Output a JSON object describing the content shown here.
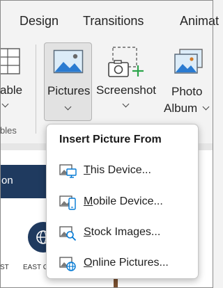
{
  "tabs": [
    "Design",
    "Transitions",
    "Animat"
  ],
  "ribbon": {
    "table_label": "able",
    "tables_group_label": "bles",
    "pictures_label": "Pictures",
    "screenshot_label": "Screenshot",
    "photo_album_label_1": "Photo",
    "photo_album_label_2": "Album"
  },
  "menu": {
    "title": "Insert Picture From",
    "items": [
      {
        "label": "This Device...",
        "icon": "this-device-icon"
      },
      {
        "label": "Mobile Device...",
        "icon": "mobile-device-icon"
      },
      {
        "label": "Stock Images...",
        "icon": "stock-images-icon"
      },
      {
        "label": "Online Pictures...",
        "icon": "online-pictures-icon"
      }
    ]
  },
  "slide": {
    "banner_text": "on",
    "caption_left": "ST",
    "caption_mid": "EAST C"
  },
  "colors": {
    "accent": "#0078d4",
    "green_plus": "#2aa44a",
    "slide_banner": "#1f3a5f"
  }
}
